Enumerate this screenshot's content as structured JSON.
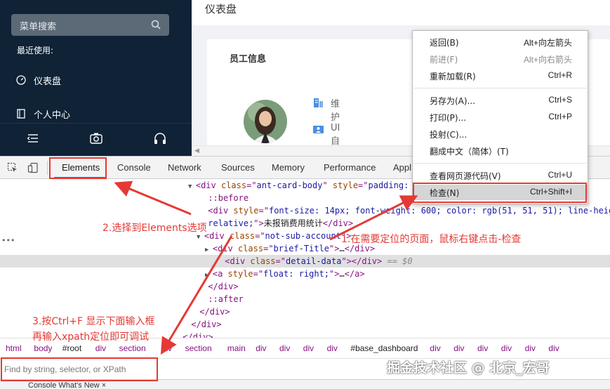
{
  "sidebar": {
    "search_placeholder": "菜单搜索",
    "recent_title": "最近使用:",
    "items": [
      {
        "label": "仪表盘",
        "icon": "dashboard-icon"
      },
      {
        "label": "个人中心",
        "icon": "document-icon"
      }
    ],
    "bottom_icons": [
      "menu-fold-icon",
      "camera-icon",
      "headphones-icon"
    ]
  },
  "main": {
    "page_title": "仪表盘",
    "card_title": "员工信息",
    "tags": [
      {
        "label": "维护",
        "icon": "building-icon"
      },
      {
        "label": "UI自动化",
        "icon": "team-icon"
      }
    ]
  },
  "devtools": {
    "tabs": [
      "Elements",
      "Console",
      "Network",
      "Sources",
      "Memory",
      "Performance",
      "Appl"
    ],
    "active_tab": "Elements",
    "code_lines": [
      {
        "indent": 0,
        "tri": "▼",
        "parts": [
          [
            "tg",
            "<div "
          ],
          [
            "at",
            "class"
          ],
          [
            "tg",
            "=\""
          ],
          [
            "av",
            "ant-card-body"
          ],
          [
            "tg",
            "\" "
          ],
          [
            "at",
            "style"
          ],
          [
            "tg",
            "=\""
          ],
          [
            "av",
            "padding:"
          ]
        ]
      },
      {
        "indent": 1,
        "tri": "",
        "parts": [
          [
            "ps",
            "::before"
          ]
        ]
      },
      {
        "indent": 1,
        "tri": "",
        "parts": [
          [
            "tg",
            "<div "
          ],
          [
            "at",
            "style"
          ],
          [
            "tg",
            "=\""
          ],
          [
            "av",
            "font-size: 14px; font-weight: 600; color: rgb(51, 51, 51); line-heig"
          ]
        ]
      },
      {
        "indent": 1,
        "tri": "",
        "parts": [
          [
            "av",
            "relative;"
          ],
          [
            "tg",
            "\">"
          ],
          [
            "tx",
            "未报销费用统计"
          ],
          [
            "tg",
            "</div>"
          ]
        ]
      },
      {
        "indent": 1,
        "tri": "▼",
        "parts": [
          [
            "tg",
            "<div "
          ],
          [
            "at",
            "class"
          ],
          [
            "tg",
            "=\""
          ],
          [
            "av",
            "not-sub-account"
          ],
          [
            "tg",
            "\">"
          ]
        ]
      },
      {
        "indent": 2,
        "tri": "▶",
        "parts": [
          [
            "tg",
            "<div "
          ],
          [
            "at",
            "class"
          ],
          [
            "tg",
            "=\""
          ],
          [
            "av",
            "brief-Title"
          ],
          [
            "tg",
            "\">"
          ],
          [
            "tx",
            "…"
          ],
          [
            "tg",
            "</div>"
          ]
        ]
      },
      {
        "indent": 2,
        "tri": "",
        "parts": [
          [
            "tg",
            "<div "
          ],
          [
            "at",
            "class"
          ],
          [
            "tg",
            "=\""
          ],
          [
            "av",
            "detail-data"
          ],
          [
            "tg",
            "\"></div>"
          ],
          [
            "cm",
            " == $0"
          ]
        ]
      },
      {
        "indent": 2,
        "tri": "▶",
        "parts": [
          [
            "tg",
            "<a "
          ],
          [
            "at",
            "style"
          ],
          [
            "tg",
            "=\""
          ],
          [
            "av",
            "float: right;"
          ],
          [
            "tg",
            "\">"
          ],
          [
            "tx",
            "…"
          ],
          [
            "tg",
            "</a>"
          ]
        ]
      },
      {
        "indent": 1,
        "tri": "",
        "parts": [
          [
            "tg",
            "</div>"
          ]
        ]
      },
      {
        "indent": 1,
        "tri": "",
        "parts": [
          [
            "ps",
            "::after"
          ]
        ]
      },
      {
        "indent": 0,
        "tri": "",
        "parts": [
          [
            "tg",
            "</div>"
          ]
        ]
      },
      {
        "indent": -1,
        "tri": "",
        "parts": [
          [
            "tg",
            "</div>"
          ]
        ]
      },
      {
        "indent": -2,
        "tri": "",
        "parts": [
          [
            "tg",
            "</div>"
          ]
        ]
      }
    ],
    "breadcrumbs": [
      "html",
      "body",
      "#root",
      "div",
      "section",
      "div",
      "section",
      "main",
      "div",
      "div",
      "div",
      "div",
      "#base_dashboard",
      "div",
      "div",
      "div",
      "div",
      "div",
      "div"
    ],
    "find_placeholder": "Find by string, selector, or XPath",
    "console_strip": "Console   What's New ×"
  },
  "context_menu": {
    "items": [
      {
        "label": "返回(B)",
        "shortcut": "Alt+向左箭头",
        "disabled": false
      },
      {
        "label": "前进(F)",
        "shortcut": "Alt+向右箭头",
        "disabled": true
      },
      {
        "label": "重新加载(R)",
        "shortcut": "Ctrl+R",
        "disabled": false
      },
      {
        "label": "另存为(A)...",
        "shortcut": "Ctrl+S",
        "disabled": false
      },
      {
        "label": "打印(P)...",
        "shortcut": "Ctrl+P",
        "disabled": false
      },
      {
        "label": "投射(C)...",
        "shortcut": "",
        "disabled": false
      },
      {
        "label": "翻成中文（简体）(T)",
        "shortcut": "",
        "disabled": false
      },
      {
        "label": "查看网页源代码(V)",
        "shortcut": "Ctrl+U",
        "disabled": false
      },
      {
        "label": "检查(N)",
        "shortcut": "Ctrl+Shift+I",
        "disabled": false
      }
    ]
  },
  "annotations": {
    "step1": "1.在需要定位的页面，鼠标右键点击-检查",
    "step2": "2.选择到Elements选项",
    "step3_line1": "3.按Ctrl+F 显示下面输入框",
    "step3_line2": "再输入xpath定位即可调试"
  },
  "watermark": "掘金技术社区 @ 北京_宏哥",
  "colors": {
    "annotation": "#e53935",
    "sidebar_bg": "#0f2236",
    "accent": "#1a73e8"
  }
}
